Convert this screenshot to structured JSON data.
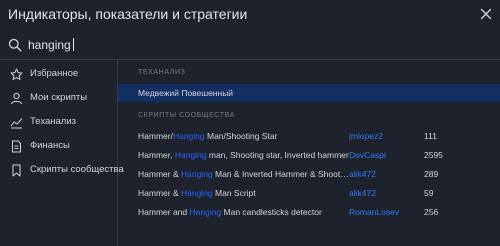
{
  "header": {
    "title": "Индикаторы, показатели и стратегии"
  },
  "search": {
    "value": "hanging",
    "placeholder": ""
  },
  "sidebar": {
    "items": [
      {
        "label": "Избранное",
        "icon": "star-icon"
      },
      {
        "label": "Мои скрипты",
        "icon": "user-icon"
      },
      {
        "label": "Теханализ",
        "icon": "chart-line-icon"
      },
      {
        "label": "Финансы",
        "icon": "document-icon"
      },
      {
        "label": "Скрипты сообщества",
        "icon": "bookmark-icon"
      }
    ]
  },
  "highlight_term": "hanging",
  "results": {
    "tech": {
      "header": "ТЕХАНАЛИЗ",
      "items": [
        {
          "name": "Медвежий Повешенный",
          "selected": true
        }
      ]
    },
    "community": {
      "header": "СКРИПТЫ СООБЩЕСТВА",
      "items": [
        {
          "name": "Hammer/Hanging Man/Shooting Star",
          "author": "jmlopez2",
          "count": "111"
        },
        {
          "name": "Hammer, Hanging man, Shooting star, Inverted hammer",
          "author": "DovCaspi",
          "count": "2595"
        },
        {
          "name": "Hammer & Hanging Man & Inverted Hammer & Shooting Star",
          "author": "alik472",
          "count": "289"
        },
        {
          "name": "Hammer & Hanging Man Script",
          "author": "alik472",
          "count": "59"
        },
        {
          "name": "Hammer and Hanging Man candlesticks detector",
          "author": "RomanLosev",
          "count": "256"
        }
      ]
    }
  },
  "colors": {
    "background": "#1e222d",
    "selected_row": "#142e61",
    "highlight": "#2962ff",
    "author_link": "#3179f5",
    "muted": "#787b86"
  }
}
